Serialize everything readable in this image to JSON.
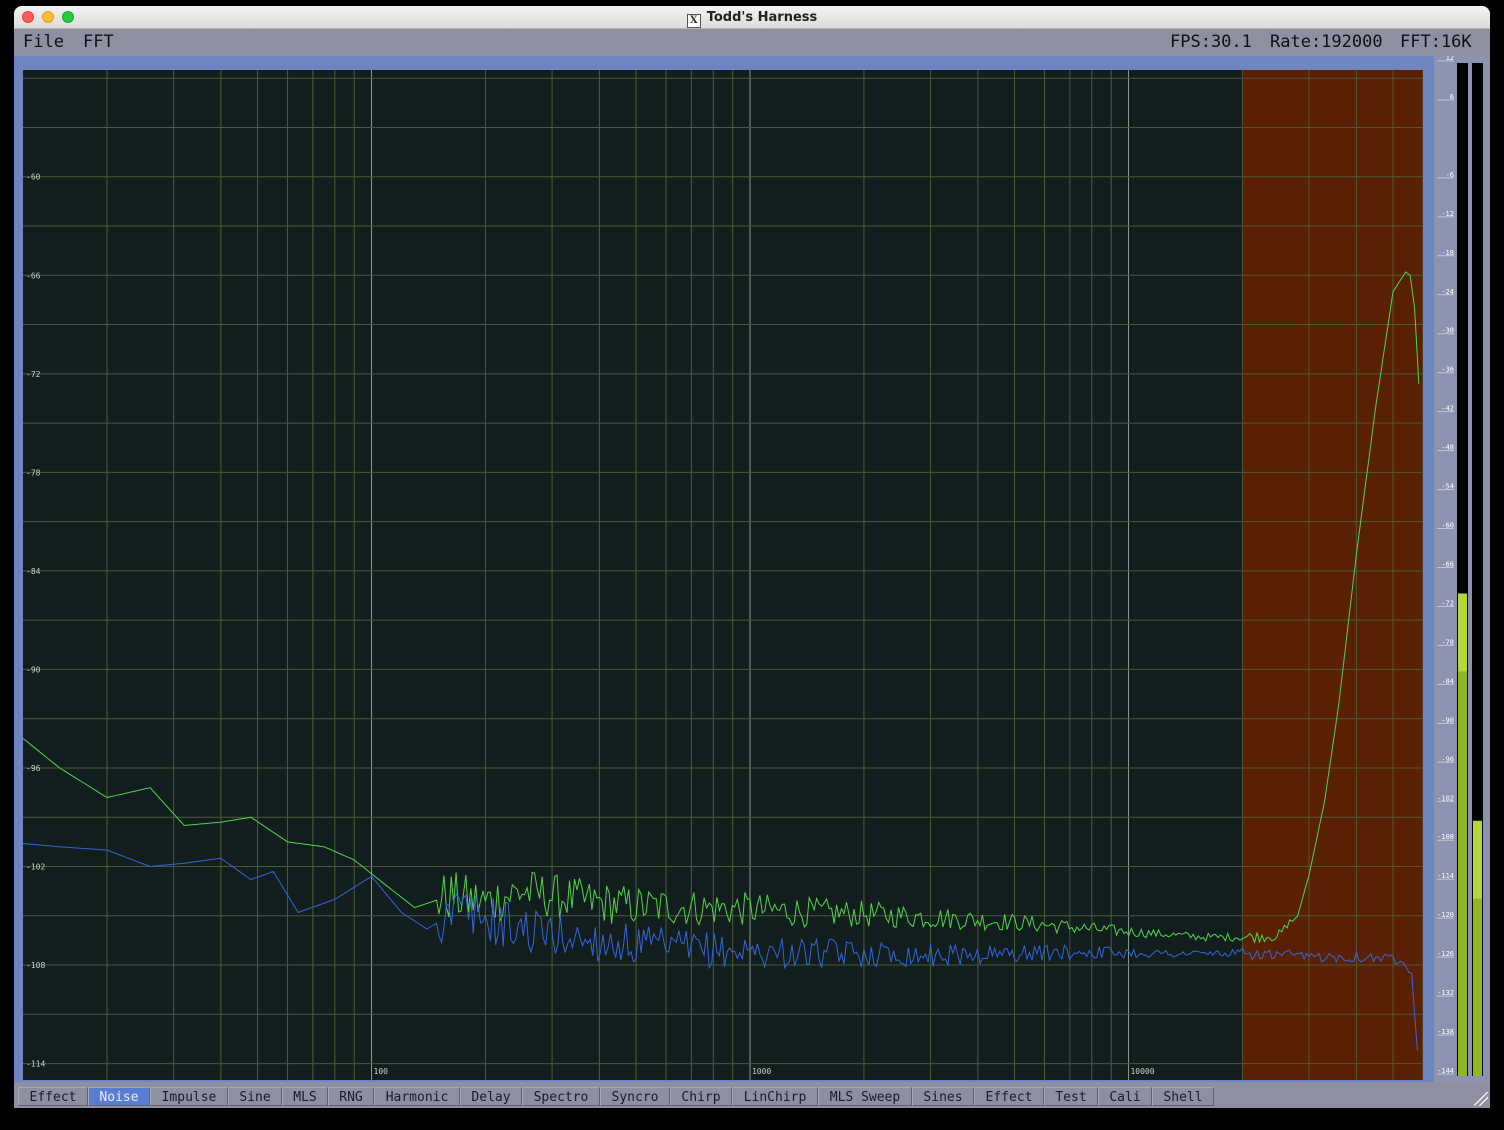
{
  "window": {
    "title": "Todd's Harness"
  },
  "menu": {
    "file": "File",
    "fft": "FFT"
  },
  "status": {
    "fps": "FPS:30.1",
    "rate": "Rate:192000",
    "fft": "FFT:16K"
  },
  "colors": {
    "plot_bg": "#121e1e",
    "highlight_band": "#5a2004",
    "grid": "#4c5a38",
    "decade_grid": "#8a9a88",
    "trace_green": "#52d34a",
    "trace_blue": "#3565d8",
    "meter_green": "#8fb820",
    "meter_bright": "#b5d836"
  },
  "chart_data": {
    "type": "line",
    "x_scale": "log",
    "xlim": [
      12,
      60000
    ],
    "ylim": [
      -115,
      -53.5
    ],
    "grid": true,
    "x_ticks": [
      {
        "value": 100,
        "label": "100"
      },
      {
        "value": 1000,
        "label": "1000"
      },
      {
        "value": 10000,
        "label": "10000"
      }
    ],
    "y_ticks": [
      {
        "value": -60,
        "label": "-60"
      },
      {
        "value": -66,
        "label": "-66"
      },
      {
        "value": -72,
        "label": "-72"
      },
      {
        "value": -78,
        "label": "-78"
      },
      {
        "value": -84,
        "label": "-84"
      },
      {
        "value": -90,
        "label": "-90"
      },
      {
        "value": -96,
        "label": "-96"
      },
      {
        "value": -102,
        "label": "-102"
      },
      {
        "value": -108,
        "label": "-108"
      },
      {
        "value": -114,
        "label": "-114"
      }
    ],
    "highlight_region": [
      20000,
      60000
    ],
    "series": [
      {
        "color": "green",
        "points": [
          [
            12,
            -94.2
          ],
          [
            15,
            -96
          ],
          [
            20,
            -97.8
          ],
          [
            26,
            -97.2
          ],
          [
            32,
            -99.5
          ],
          [
            40,
            -99.3
          ],
          [
            48,
            -99
          ],
          [
            60,
            -100.5
          ],
          [
            75,
            -100.8
          ],
          [
            90,
            -101.6
          ],
          [
            110,
            -103.2
          ],
          [
            130,
            -104.5
          ],
          [
            160,
            -103.8
          ],
          [
            200,
            -104.2
          ],
          [
            250,
            -103.5
          ],
          [
            300,
            -103.8
          ],
          [
            400,
            -104.2
          ],
          [
            500,
            -104.4
          ],
          [
            700,
            -104.5
          ],
          [
            1000,
            -104.6
          ],
          [
            1500,
            -104.8
          ],
          [
            2000,
            -104.9
          ],
          [
            3000,
            -105.1
          ],
          [
            5000,
            -105.4
          ],
          [
            8000,
            -105.8
          ],
          [
            12000,
            -106.1
          ],
          [
            16000,
            -106.3
          ],
          [
            20000,
            -106.3
          ],
          [
            25000,
            -106.2
          ],
          [
            28000,
            -105
          ],
          [
            30000,
            -102.5
          ],
          [
            33000,
            -98
          ],
          [
            36000,
            -92
          ],
          [
            40000,
            -83
          ],
          [
            45000,
            -74
          ],
          [
            50000,
            -67
          ],
          [
            54000,
            -65.8
          ],
          [
            55500,
            -66
          ],
          [
            57000,
            -68
          ],
          [
            58500,
            -72.6
          ]
        ]
      },
      {
        "color": "blue",
        "points": [
          [
            12,
            -100.6
          ],
          [
            15,
            -100.8
          ],
          [
            20,
            -101
          ],
          [
            26,
            -102
          ],
          [
            32,
            -101.8
          ],
          [
            40,
            -101.5
          ],
          [
            48,
            -102.8
          ],
          [
            55,
            -102.3
          ],
          [
            64,
            -104.8
          ],
          [
            80,
            -104
          ],
          [
            100,
            -102.6
          ],
          [
            120,
            -104.8
          ],
          [
            140,
            -105.8
          ],
          [
            170,
            -104.7
          ],
          [
            200,
            -105.2
          ],
          [
            260,
            -105.9
          ],
          [
            350,
            -106.4
          ],
          [
            500,
            -106.8
          ],
          [
            700,
            -107
          ],
          [
            1000,
            -107.2
          ],
          [
            1500,
            -107.3
          ],
          [
            2000,
            -107.3
          ],
          [
            3000,
            -107.4
          ],
          [
            5000,
            -107.3
          ],
          [
            8000,
            -107.2
          ],
          [
            12000,
            -107.3
          ],
          [
            20000,
            -107.3
          ],
          [
            30000,
            -107.5
          ],
          [
            40000,
            -107.5
          ],
          [
            50000,
            -107.6
          ],
          [
            54000,
            -107.8
          ],
          [
            56000,
            -108.5
          ],
          [
            57000,
            -111
          ],
          [
            58000,
            -113.2
          ]
        ]
      }
    ]
  },
  "meter": {
    "ticks": [
      "12",
      "6",
      "-6",
      "-12",
      "-18",
      "-24",
      "-30",
      "-36",
      "-42",
      "-48",
      "-54",
      "-60",
      "-66",
      "-72",
      "-78",
      "-84",
      "-90",
      "-96",
      "-102",
      "-108",
      "-114",
      "-120",
      "-126",
      "-132",
      "-138",
      "-144"
    ],
    "range_db": [
      12,
      -144
    ],
    "left_level_db": -70,
    "right_level_db": -105
  },
  "tabs": [
    {
      "label": "Effect",
      "active": false
    },
    {
      "label": "Noise",
      "active": true
    },
    {
      "label": "Impulse",
      "active": false
    },
    {
      "label": "Sine",
      "active": false
    },
    {
      "label": "MLS",
      "active": false
    },
    {
      "label": "RNG",
      "active": false
    },
    {
      "label": "Harmonic",
      "active": false
    },
    {
      "label": "Delay",
      "active": false
    },
    {
      "label": "Spectro",
      "active": false
    },
    {
      "label": "Syncro",
      "active": false
    },
    {
      "label": "Chirp",
      "active": false
    },
    {
      "label": "LinChirp",
      "active": false
    },
    {
      "label": "MLS Sweep",
      "active": false
    },
    {
      "label": "Sines",
      "active": false
    },
    {
      "label": "Effect",
      "active": false
    },
    {
      "label": "Test",
      "active": false
    },
    {
      "label": "Cali",
      "active": false
    },
    {
      "label": "Shell",
      "active": false
    }
  ]
}
